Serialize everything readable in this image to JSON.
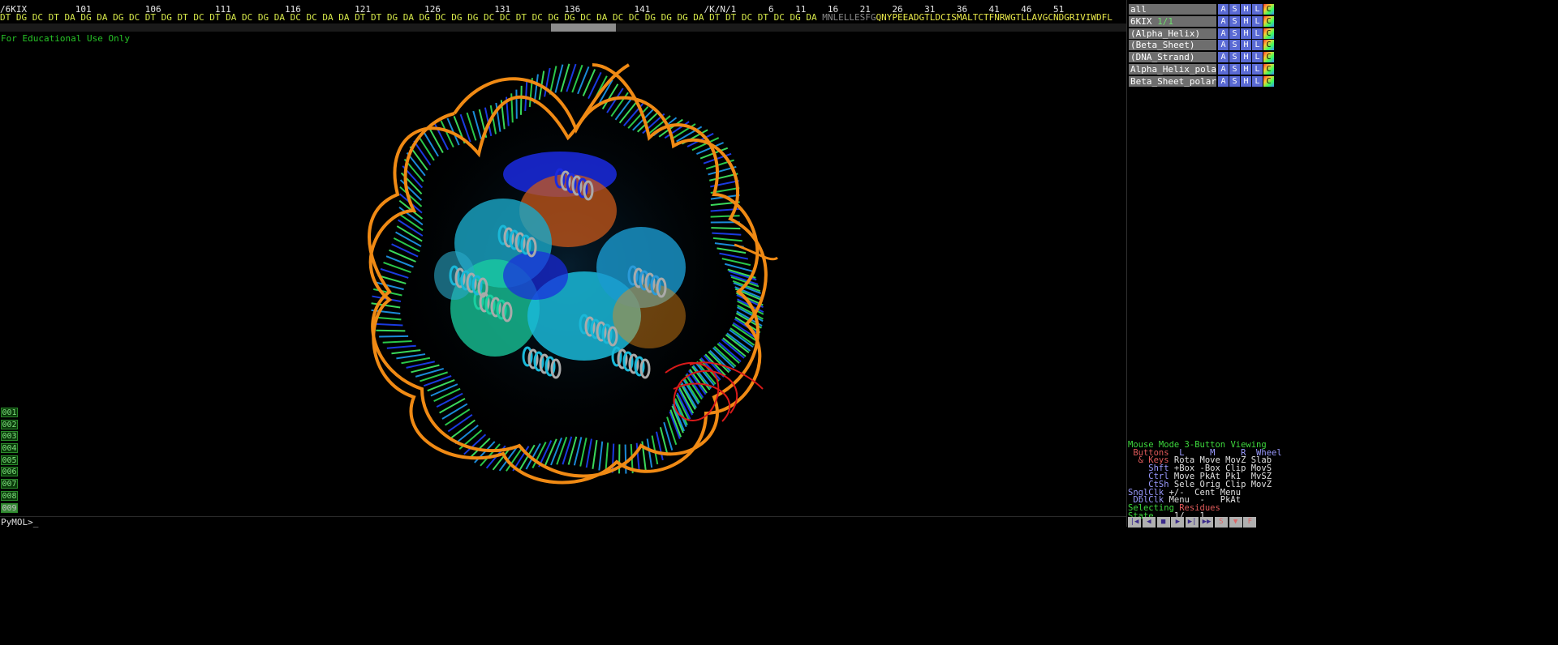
{
  "sequence": {
    "numbers_line": "/6KIX         101          106          111          116          121          126          131          136          141          /K/N/1      6    11    16    21    26    31    36    41    46    51",
    "dna_residues": "DT DG DC DT DA DG DA DG DC DT DG DT DC DT DA DC DG DA DC DC DA DA DT DT DG DA DG DC DG DG DC DC DT DC DG DG DC DA DC DC DG DG DG DA DT DT DC DT DC DG DA",
    "protein_gray": "MNLELLESFG",
    "protein_yellow": "QNYPEEADGTLDCISMALTCTFNRWGTLLAVGCNDGRIVIWDFL"
  },
  "viewer": {
    "watermark": "For Educational Use Only",
    "scenes": [
      "001",
      "002",
      "003",
      "004",
      "005",
      "006",
      "007",
      "008",
      "009"
    ],
    "active_scene": "009"
  },
  "objects": [
    {
      "name": "all",
      "count": ""
    },
    {
      "name": "6KIX",
      "count": "1/1"
    },
    {
      "name": "(Alpha_Helix)",
      "count": ""
    },
    {
      "name": "(Beta_Sheet)",
      "count": ""
    },
    {
      "name": "(DNA_Strand)",
      "count": ""
    },
    {
      "name": "Alpha_Helix_pola",
      "count": ""
    },
    {
      "name": "Beta_Sheet_polar",
      "count": ""
    }
  ],
  "object_buttons": [
    "A",
    "S",
    "H",
    "L",
    "C"
  ],
  "mouse": {
    "line1_a": "Mouse Mode ",
    "line1_b": "3-Button Viewing",
    "line2_a": " Buttons ",
    "line2_b": " L     M     R  Wheel",
    "line3_a": "  & Keys ",
    "line3_b": "Rota Move MovZ Slab",
    "line4_a": "    Shft ",
    "line4_b": "+Box -Box Clip MovS",
    "line5_a": "    Ctrl ",
    "line5_b": "Move PkAt Pk1  MvSZ",
    "line6_a": "    CtSh ",
    "line6_b": "Sele Orig Clip MovZ",
    "line7_a": "SnglClk ",
    "line7_b": "+/-  Cent Menu",
    "line8_a": " DblClk ",
    "line8_b": "Menu  -   PkAt",
    "line9_a": "Selecting ",
    "line9_b": "Residues",
    "line10_a": "State ",
    "line10_b": "   1/   1"
  },
  "transport": [
    "|◀",
    "◀",
    "■",
    "▶",
    "▶|",
    "▶▶",
    "S",
    "▼",
    "F"
  ],
  "command": {
    "prompt": "PyMOL>_"
  },
  "colors": {
    "dna_backbone": "#f08a14",
    "helix_cyan": "#1ab8d8",
    "helix_blue": "#1a2ae0",
    "sheet_orange": "#c8581a",
    "loop_red": "#d81a1a"
  }
}
